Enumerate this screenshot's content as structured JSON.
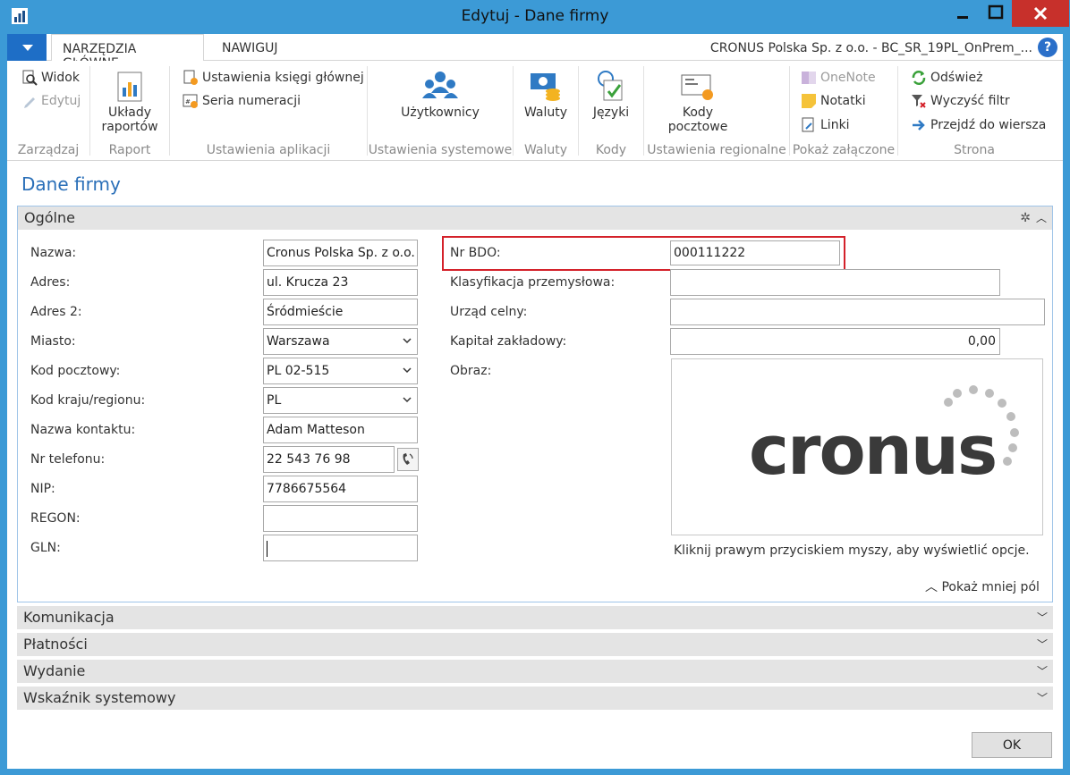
{
  "window": {
    "title": "Edytuj - Dane firmy"
  },
  "ribbon_tabs": {
    "home": "NARZĘDZIA GŁÓWNE",
    "navigate": "NAWIGUJ"
  },
  "company_line": "CRONUS Polska Sp. z o.o. - BC_SR_19PL_OnPrem_...",
  "help_label": "?",
  "ribbon": {
    "manage": {
      "label": "Zarządzaj",
      "view": "Widok",
      "edit": "Edytuj"
    },
    "report": {
      "label": "Raport",
      "layouts": "Układy raportów"
    },
    "app_settings": {
      "label": "Ustawienia aplikacji",
      "gl_setup": "Ustawienia księgi głównej",
      "no_series": "Seria numeracji"
    },
    "system_settings": {
      "label": "Ustawienia systemowe",
      "users": "Użytkownicy"
    },
    "currencies": {
      "label": "Waluty",
      "currencies": "Waluty"
    },
    "codes": {
      "label": "Kody",
      "languages": "Języki"
    },
    "regional": {
      "label": "Ustawienia regionalne",
      "post_codes": "Kody pocztowe"
    },
    "attachments": {
      "label": "Pokaż załączone",
      "onenote": "OneNote",
      "notes": "Notatki",
      "links": "Linki"
    },
    "page": {
      "label": "Strona",
      "refresh": "Odśwież",
      "clear_filter": "Wyczyść filtr",
      "goto_row": "Przejdź do wiersza"
    }
  },
  "page_title": "Dane firmy",
  "general": {
    "title": "Ogólne",
    "left_fields": [
      {
        "label": "Nazwa:",
        "value": "Cronus Polska Sp. z o.o."
      },
      {
        "label": "Adres:",
        "value": "ul. Krucza 23"
      },
      {
        "label": "Adres 2:",
        "value": "Śródmieście"
      },
      {
        "label": "Miasto:",
        "value": "Warszawa"
      },
      {
        "label": "Kod pocztowy:",
        "value": "PL 02-515"
      },
      {
        "label": "Kod kraju/regionu:",
        "value": "PL"
      },
      {
        "label": "Nazwa kontaktu:",
        "value": "Adam Matteson"
      },
      {
        "label": "Nr telefonu:",
        "value": "22 543 76 98"
      },
      {
        "label": "NIP:",
        "value": "7786675564"
      },
      {
        "label": "REGON:",
        "value": ""
      },
      {
        "label": "GLN:",
        "value": ""
      }
    ],
    "right_fields": [
      {
        "label": "Nr BDO:",
        "value": "000111222"
      },
      {
        "label": "Klasyfikacja przemysłowa:",
        "value": ""
      },
      {
        "label": "Urząd celny:",
        "value": ""
      },
      {
        "label": "Kapitał zakładowy:",
        "value": "0,00"
      },
      {
        "label": "Obraz:",
        "value": ""
      }
    ],
    "picture_logo": "cronus",
    "picture_hint": "Kliknij prawym przyciskiem myszy, aby wyświetlić opcje.",
    "show_less": "Pokaż mniej pól"
  },
  "collapsed_tabs": [
    "Komunikacja",
    "Płatności",
    "Wydanie",
    "Wskaźnik systemowy"
  ],
  "ok_button": "OK",
  "colors": {
    "title_bar": "#3c9ad6",
    "accent": "#2a6fb8",
    "highlight": "#d4212a",
    "close": "#c7302b"
  }
}
